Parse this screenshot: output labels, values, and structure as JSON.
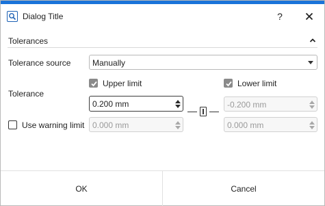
{
  "window": {
    "title": "Dialog Title",
    "help_label": "?",
    "accent_color": "#1a73d9",
    "title_icon": "search-icon",
    "close_icon": "close-icon"
  },
  "section": {
    "title": "Tolerances",
    "collapse_icon": "chevron-up-icon"
  },
  "tolerance_source": {
    "label": "Tolerance source",
    "value": "Manually"
  },
  "tolerance": {
    "label": "Tolerance",
    "upper": {
      "label": "Upper limit",
      "checked": true,
      "value": "0.200 mm"
    },
    "lower": {
      "label": "Lower limit",
      "checked": true,
      "value": "-0.200 mm"
    },
    "link_icon": "link-symmetric-icon"
  },
  "warning": {
    "label": "Use warning limit",
    "checked": false,
    "upper_value": "0.000 mm",
    "lower_value": "0.000 mm"
  },
  "footer": {
    "ok_label": "OK",
    "cancel_label": "Cancel"
  }
}
